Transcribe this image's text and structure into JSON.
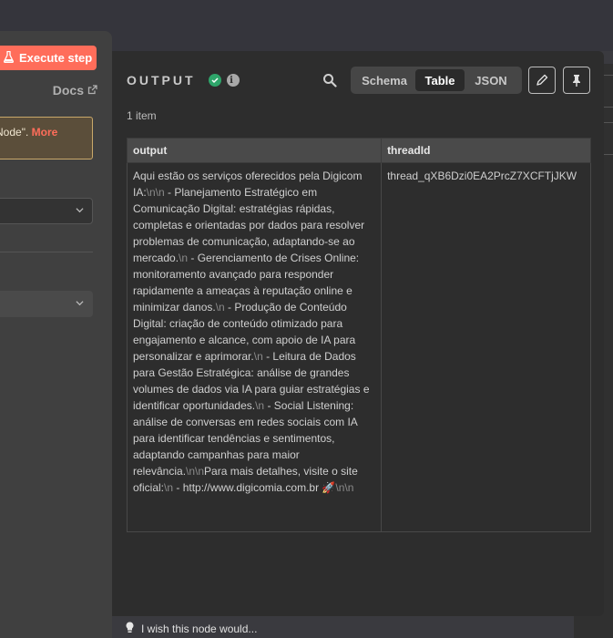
{
  "left_panel": {
    "execute_label": "Execute step",
    "docs_label": "Docs",
    "callout_text": "Node\".",
    "callout_more": "More"
  },
  "output": {
    "title": "OUTPUT",
    "item_count": "1 item",
    "tabs": [
      {
        "label": "Schema",
        "active": false
      },
      {
        "label": "Table",
        "active": true
      },
      {
        "label": "JSON",
        "active": false
      }
    ],
    "columns": [
      "output",
      "threadId"
    ],
    "rows": [
      {
        "output_segments": [
          "Aqui estão os serviços oferecidos pela Digicom IA:",
          "\\n\\n",
          " - Planejamento Estratégico em Comunicação Digital: estratégias rápidas, completas e orientadas por dados para resolver problemas de comunicação, adaptando-se ao mercado.",
          "\\n",
          " - Gerenciamento de Crises Online: monitoramento avançado para responder rapidamente a ameaças à reputação online e minimizar danos.",
          "\\n",
          " - Produção de Conteúdo Digital: criação de conteúdo otimizado para engajamento e alcance, com apoio de IA para personalizar e aprimorar.",
          "\\n",
          " - Leitura de Dados para Gestão Estratégica: análise de grandes volumes de dados via IA para guiar estratégias e identificar oportunidades.",
          "\\n",
          " - Social Listening: análise de conversas em redes sociais com IA para identificar tendências e sentimentos, adaptando campanhas para maior relevância.",
          "\\n\\n",
          "Para mais detalhes, visite o site oficial:",
          "\\n",
          " - http://www.digicomia.com.br ",
          "🚀",
          "\\n\\n"
        ],
        "threadId": "thread_qXB6Dzi0EA2PrcZ7XCFTjJKW"
      }
    ]
  },
  "footer": {
    "wish_label": "I wish this node would..."
  },
  "colors": {
    "accent": "#ff6d5a",
    "success": "#2ea56a",
    "panel": "#2d2d2d"
  }
}
